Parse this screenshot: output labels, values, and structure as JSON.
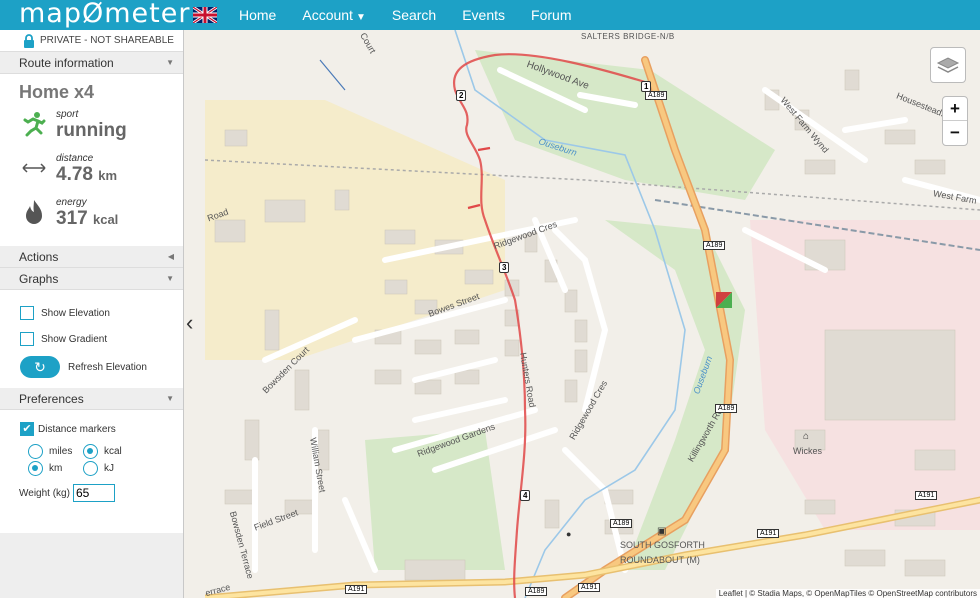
{
  "header": {
    "logo": "mapØmeter",
    "nav": [
      {
        "label": "Home"
      },
      {
        "label": "Account"
      },
      {
        "label": "Search"
      },
      {
        "label": "Events"
      },
      {
        "label": "Forum"
      }
    ]
  },
  "sidebar": {
    "privacy": "PRIVATE - NOT SHAREABLE",
    "route_info": "Route information",
    "route_name": "Home x4",
    "stats": {
      "sport": {
        "label": "sport",
        "value": "running",
        "icon": "running-icon"
      },
      "distance": {
        "label": "distance",
        "value": "4.78",
        "unit": "km",
        "icon": "distance-arrows-icon"
      },
      "energy": {
        "label": "energy",
        "value": "317",
        "unit": "kcal",
        "icon": "flame-icon"
      }
    },
    "actions": "Actions",
    "graphs": "Graphs",
    "show_elevation": "Show Elevation",
    "show_gradient": "Show Gradient",
    "refresh_elevation": "Refresh Elevation",
    "preferences": "Preferences",
    "distance_markers": "Distance markers",
    "units": {
      "miles": "miles",
      "kcal": "kcal",
      "km": "km",
      "kj": "kJ"
    },
    "weight_label": "Weight (kg)",
    "weight_value": "65"
  },
  "map": {
    "zoom_in": "+",
    "zoom_out": "−",
    "attribution": "Leaflet | © Stadia Maps, © OpenMapTiles © OpenStreetMap contributors",
    "streets": [
      "SALTERS BRIDGE-N/B",
      "Hollywood Ave",
      "Housesteads",
      "West Farm Wynd",
      "West Farm",
      "Ouseburn",
      "Ridgewood Cres",
      "Bowes Street",
      "Bowsden Court",
      "Hunters Road",
      "Ridgewood Gardens",
      "William Street",
      "Field Street",
      "Bowsden Terrace",
      "Killingworth Rd",
      "Wickes",
      "SOUTH GOSFORTH",
      "ROUNDABOUT (M)",
      "Road",
      "Court",
      "errace"
    ],
    "road_refs": [
      "A189",
      "A191"
    ],
    "markers": [
      "1",
      "2",
      "3",
      "4"
    ]
  }
}
